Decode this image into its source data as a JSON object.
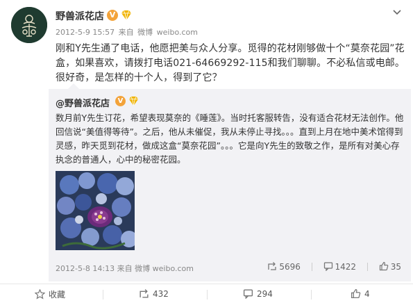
{
  "post": {
    "author": "野兽派花店",
    "timestamp": "2012-5-9 15:57",
    "via_prefix": "来自",
    "via": "微博",
    "domain": "weibo.com",
    "text": "刚和Y先生通了电话，他愿把美与众人分享。觅得的花材刚够做十个“莫奈花园”花盒，如果喜欢，请拨打电话021-64669292-115和我们聊聊。不必私信或电邮。很好奇，是怎样的十个人，得到了它？"
  },
  "repost": {
    "author": "@野兽派花店",
    "text": "数月前Y先生订花，希望表现莫奈的《睡莲》。当时托客服转告，没有适合花材无法创作。他回信说“美值得等待”。之后，他从未催促，我从未停止寻找。。。直到上月在地中美术馆得到灵感，昨天觅到花材，做成这盒“莫奈花园”。。。它是向Y先生的致敬之作，是所有对美心存执念的普通人，心中的秘密花园。",
    "timestamp": "2012-5-8 14:13",
    "via_prefix": "来自",
    "via": "微博",
    "domain": "weibo.com",
    "reposts": "5696",
    "comments": "1422",
    "likes": "35"
  },
  "actions": {
    "favorite": "收藏",
    "repost": "432",
    "comment": "294",
    "like": "4"
  },
  "colors": {
    "avatar_bg": "#1f3b30",
    "verified": "#f3a33a",
    "repost_bg": "#f2f2f5"
  },
  "icons": [
    "verified-icon",
    "vip-icon",
    "chevron-down-icon",
    "repost-icon",
    "comment-icon",
    "like-icon",
    "star-icon"
  ]
}
